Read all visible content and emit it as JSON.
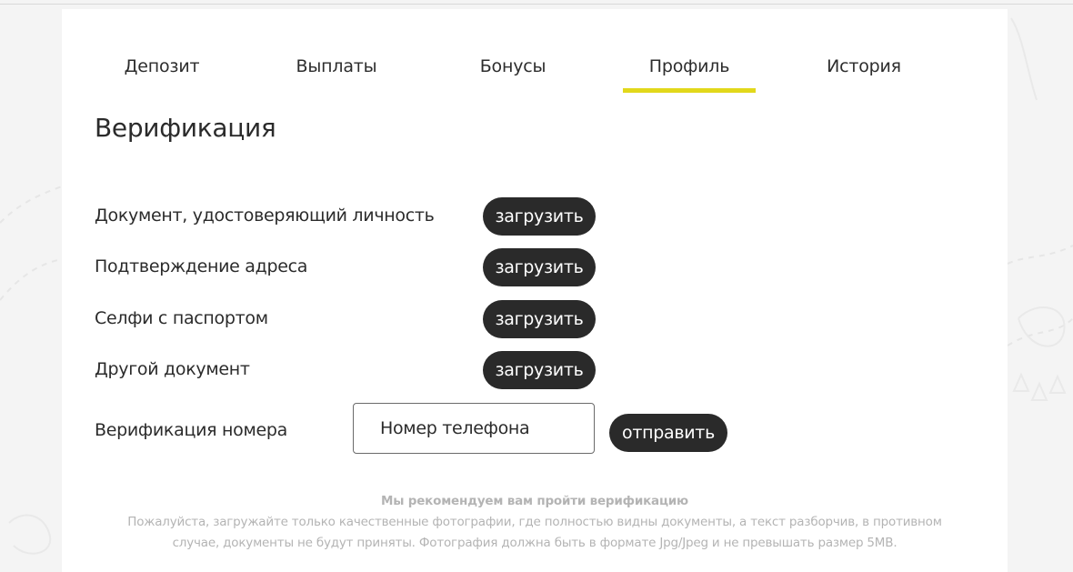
{
  "tabs": [
    {
      "label": "Депозит",
      "active": false
    },
    {
      "label": "Выплаты",
      "active": false
    },
    {
      "label": "Бонусы",
      "active": false
    },
    {
      "label": "Профиль",
      "active": true
    },
    {
      "label": "История",
      "active": false
    }
  ],
  "page_title": "Верификация",
  "documents": [
    {
      "label": "Документ, удостоверяющий личность",
      "button_label": "загрузить"
    },
    {
      "label": "Подтверждение адреса",
      "button_label": "загрузить"
    },
    {
      "label": "Селфи с паспортом",
      "button_label": "загрузить"
    },
    {
      "label": "Другой документ",
      "button_label": "загрузить"
    }
  ],
  "phone_verification": {
    "label": "Верификация номера",
    "placeholder": "Номер телефона",
    "value": "",
    "button_label": "отправить"
  },
  "note": {
    "heading": "Мы рекомендуем вам пройти верификацию",
    "line1": "Пожалуйста, загружайте только качественные фотографии, где полностью видны документы, а текст разборчив, в противном",
    "line2": "случае, документы не будут приняты. Фотография должна быть в формате Jpg/Jpeg и не превышать размер 5MB."
  },
  "colors": {
    "accent_underline": "#e2d81b",
    "button_bg": "#2a2a2a",
    "button_text": "#ffffff",
    "note_text": "#b4b4b4"
  }
}
